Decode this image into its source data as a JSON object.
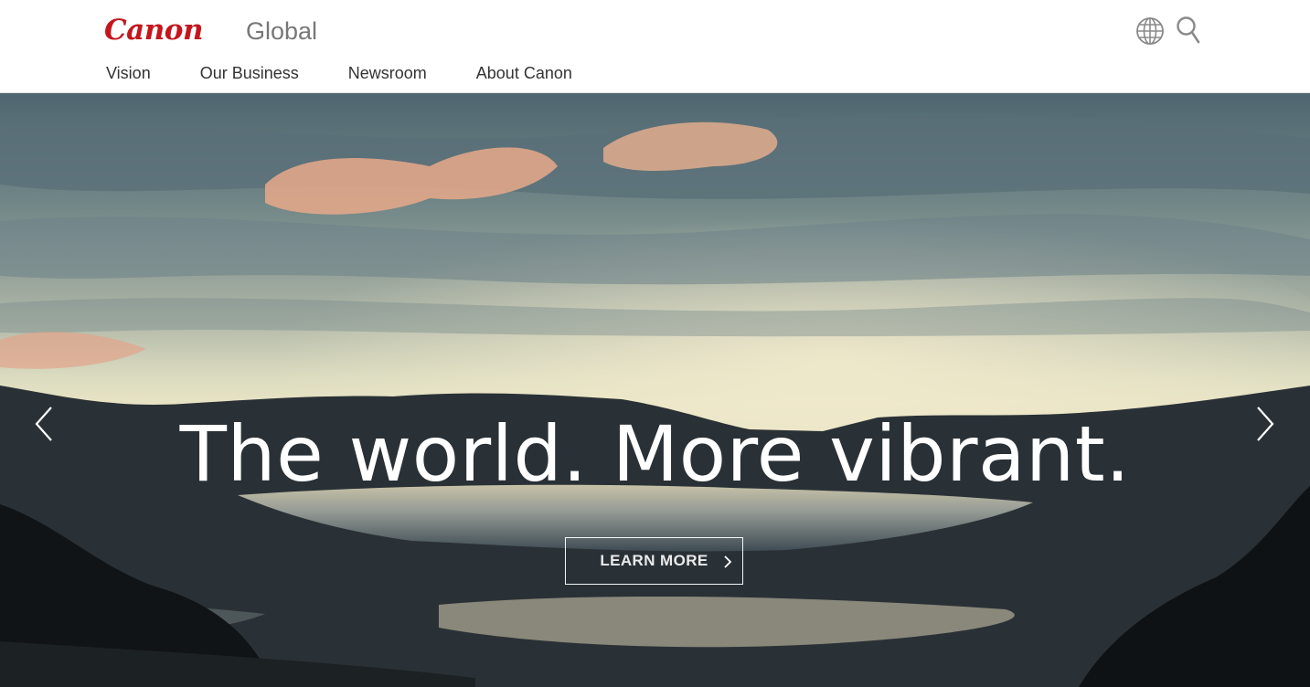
{
  "brand": {
    "logo_text": "Canon",
    "region_label": "Global",
    "accent_color": "#c4161c"
  },
  "header": {
    "globe_icon": "globe-icon",
    "search_icon": "search-icon",
    "nav": [
      {
        "label": "Vision"
      },
      {
        "label": "Our Business"
      },
      {
        "label": "Newsroom"
      },
      {
        "label": "About Canon"
      }
    ]
  },
  "hero": {
    "headline": "The world. More vibrant.",
    "cta_label": "LEARN MORE",
    "prev_icon": "chevron-left-icon",
    "next_icon": "chevron-right-icon",
    "cta_icon": "chevron-right-icon"
  }
}
